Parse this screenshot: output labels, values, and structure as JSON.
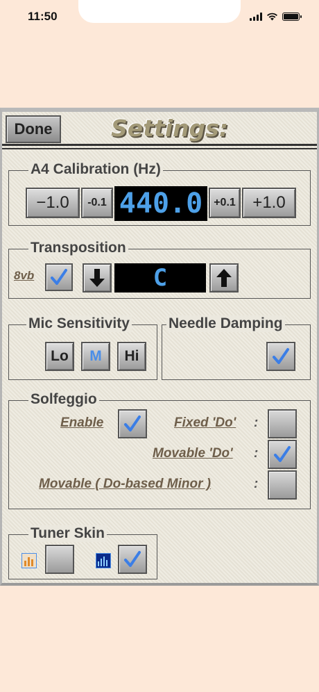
{
  "status_bar": {
    "time": "11:50"
  },
  "header": {
    "done_label": "Done",
    "title": "Settings:"
  },
  "calibration": {
    "label": "A4 Calibration (Hz)",
    "minus_large": "−1.0",
    "minus_small": "-0.1",
    "value": "440.0",
    "plus_small": "+0.1",
    "plus_large": "+1.0"
  },
  "transposition": {
    "label": "Transposition",
    "octave_label": "8vb",
    "octave_checked": true,
    "value": "C"
  },
  "mic_sensitivity": {
    "label": "Mic Sensitivity",
    "options": [
      "Lo",
      "M",
      "Hi"
    ],
    "selected": "M"
  },
  "needle_damping": {
    "label": "Needle Damping",
    "checked": true
  },
  "solfeggio": {
    "label": "Solfeggio",
    "enable_label": "Enable",
    "enable_checked": true,
    "fixed_do_label": "Fixed 'Do'",
    "fixed_do_checked": false,
    "movable_do_label": "Movable 'Do'",
    "movable_do_checked": true,
    "movable_minor_label": "Movable ( Do-based Minor )",
    "movable_minor_checked": false,
    "colon": ":"
  },
  "tuner_skin": {
    "label": "Tuner Skin",
    "skin1_checked": false,
    "skin2_checked": true
  },
  "colors": {
    "lcd_text": "#4da0e8",
    "check_blue": "#3b7ee6",
    "background": "#fde8d8"
  }
}
